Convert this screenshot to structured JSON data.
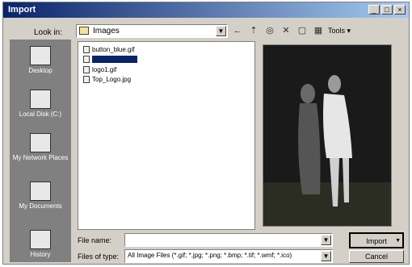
{
  "window": {
    "title": "Import",
    "btn_min": "_",
    "btn_max": "□",
    "btn_close": "×"
  },
  "lookin": {
    "label": "Look in:",
    "value": "Images"
  },
  "places": [
    {
      "label": "Desktop"
    },
    {
      "label": "Local Disk (C:)"
    },
    {
      "label": "My Network Places"
    },
    {
      "label": "My Documents"
    },
    {
      "label": "History"
    }
  ],
  "files": [
    {
      "name": "button_blue.gif"
    },
    {
      "name": "                "
    },
    {
      "name": "logo1.gif"
    },
    {
      "name": "Top_Logo.jpg"
    }
  ],
  "toolbar": {
    "views_label": "Tools ▾"
  },
  "filename": {
    "label": "File name:",
    "value": ""
  },
  "filetype": {
    "label": "Files of type:",
    "value": "All Image Files (*.gif; *.jpg; *.png; *.bmp; *.tif; *.wmf; *.ico)"
  },
  "buttons": {
    "import": "Import",
    "cancel": "Cancel"
  }
}
